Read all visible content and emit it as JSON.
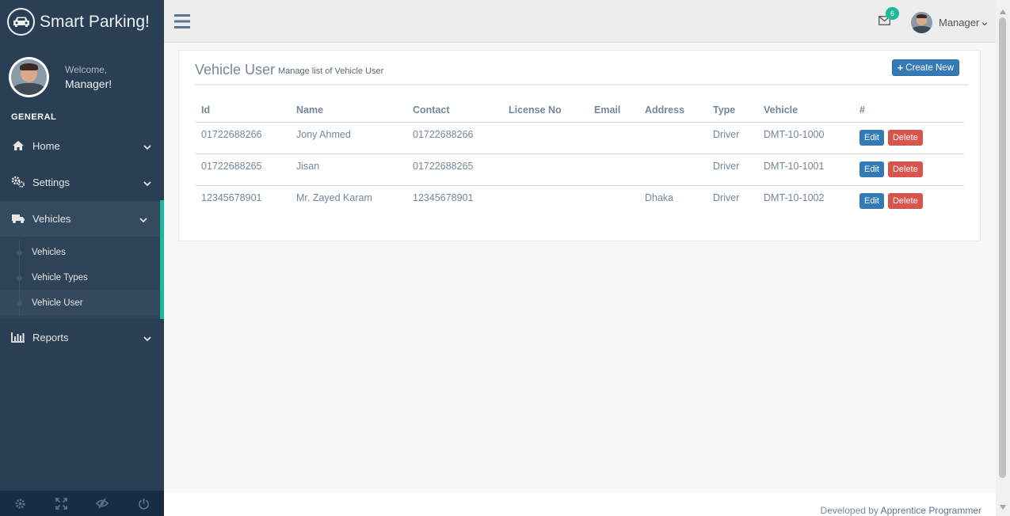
{
  "brand": {
    "title": "Smart Parking!",
    "icon": "car-icon"
  },
  "profile": {
    "welcome": "Welcome,",
    "name": "Manager!"
  },
  "sidebar": {
    "section_title": "GENERAL",
    "items": [
      {
        "label": "Home",
        "icon": "home-icon"
      },
      {
        "label": "Settings",
        "icon": "gears-icon"
      },
      {
        "label": "Vehicles",
        "icon": "truck-icon"
      },
      {
        "label": "Reports",
        "icon": "bar-chart-icon"
      }
    ],
    "vehicles_sub": [
      {
        "label": "Vehicles"
      },
      {
        "label": "Vehicle Types"
      },
      {
        "label": "Vehicle User"
      }
    ]
  },
  "topnav": {
    "mail_count": "6",
    "user_name": "Manager"
  },
  "panel": {
    "title": "Vehicle User",
    "subtitle": "Manage list of Vehicle User",
    "create_label": "Create New"
  },
  "table": {
    "headers": [
      "Id",
      "Name",
      "Contact",
      "License No",
      "Email",
      "Address",
      "Type",
      "Vehicle",
      "#"
    ],
    "rows": [
      {
        "id": "01722688266",
        "name": "Jony Ahmed",
        "contact": "01722688266",
        "license": "",
        "email": "",
        "address": "",
        "type": "Driver",
        "vehicle": "DMT-10-1000"
      },
      {
        "id": "01722688265",
        "name": "Jisan",
        "contact": "01722688265",
        "license": "",
        "email": "",
        "address": "",
        "type": "Driver",
        "vehicle": "DMT-10-1001"
      },
      {
        "id": "12345678901",
        "name": "Mr. Zayed Karam",
        "contact": "12345678901",
        "license": "",
        "email": "",
        "address": "Dhaka",
        "type": "Driver",
        "vehicle": "DMT-10-1002"
      }
    ],
    "edit_label": "Edit",
    "delete_label": "Delete"
  },
  "footer": {
    "prefix": "Developed by",
    "link": "Apprentice Programmer"
  },
  "colors": {
    "sidebar": "#2A3F54",
    "accent": "#1ABB9C",
    "primary": "#337AB7",
    "danger": "#D9534F"
  }
}
